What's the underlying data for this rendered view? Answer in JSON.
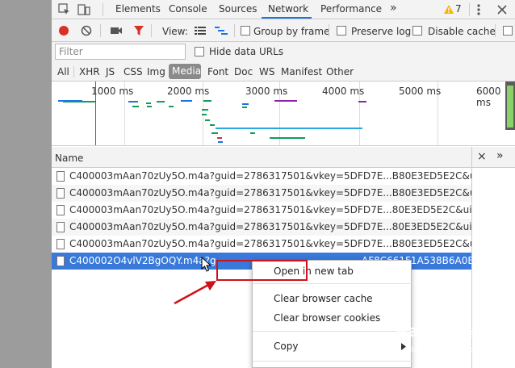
{
  "tabs": [
    "Elements",
    "Console",
    "Sources",
    "Network",
    "Performance"
  ],
  "active_tab": "Network",
  "more_tabs_glyph": "»",
  "warning_count": "7",
  "toolbar": {
    "view_label": "View:",
    "group_by_frame": "Group by frame",
    "preserve_log": "Preserve log",
    "disable_cache": "Disable cache"
  },
  "filter": {
    "placeholder": "Filter",
    "hide_data_urls": "Hide data URLs"
  },
  "types": [
    "All",
    "XHR",
    "JS",
    "CSS",
    "Img",
    "Media",
    "Font",
    "Doc",
    "WS",
    "Manifest",
    "Other"
  ],
  "active_type": "Media",
  "timeline": {
    "ticks": [
      "1000 ms",
      "2000 ms",
      "3000 ms",
      "4000 ms",
      "5000 ms",
      "6000 ms"
    ]
  },
  "table": {
    "name_header": "Name",
    "close_glyph": "×",
    "expand_glyph": "»",
    "rows": [
      "C400003mAan70zUy5O.m4a?guid=2786317501&vkey=5DFD7E...B80E3ED5E2C&uin=2205...",
      "C400003mAan70zUy5O.m4a?guid=2786317501&vkey=5DFD7E...B80E3ED5E2C&uin=2205...",
      "C400003mAan70zUy5O.m4a?guid=2786317501&vkey=5DFD7E...80E3ED5E2C&uin=2205&f...",
      "C400003mAan70zUy5O.m4a?guid=2786317501&vkey=5DFD7E...80E3ED5E2C&uin=2205&f...",
      "C400003mAan70zUy5O.m4a?guid=2786317501&vkey=5DFD7E...B80E3ED5E2C&uin=2205..."
    ],
    "selected_row_left": "C400002O4vlV2BgOQY.m4a?g",
    "selected_row_right": "AF8C661F1A538B6A0B..."
  },
  "context_menu": {
    "items": [
      "Open in new tab",
      "Clear browser cache",
      "Clear browser cookies",
      "Copy"
    ]
  },
  "watermark": {
    "logo": "Baidu",
    "subtitle": "经验",
    "url": "jingyan.baidu.com"
  },
  "colors": {
    "accent": "#1a73e8",
    "record": "#d93025",
    "selected_row": "#3879d9",
    "annotation": "#d0101a"
  }
}
